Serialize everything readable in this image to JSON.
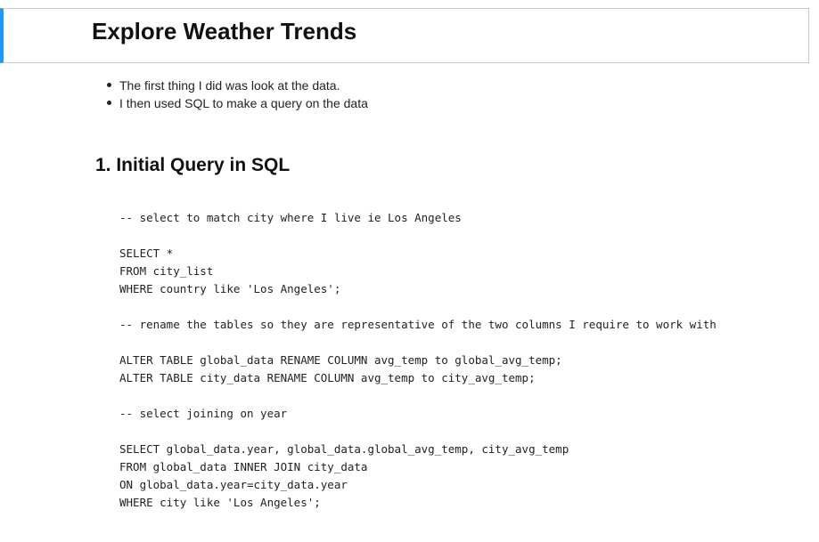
{
  "header": {
    "title": "Explore Weather Trends"
  },
  "intro": {
    "bullets": [
      "The first thing I did was look at the data.",
      "I then used SQL to make a query on the data"
    ]
  },
  "section": {
    "heading": "1. Initial Query in SQL"
  },
  "code": {
    "lines": [
      "-- select to match city where I live ie Los Angeles",
      "",
      "SELECT *",
      "FROM city_list",
      "WHERE country like 'Los Angeles';",
      "",
      "-- rename the tables so they are representative of the two columns I require to work with",
      "",
      "ALTER TABLE global_data RENAME COLUMN avg_temp to global_avg_temp;",
      "ALTER TABLE city_data RENAME COLUMN avg_temp to city_avg_temp;",
      "",
      "-- select joining on year",
      "",
      "SELECT global_data.year, global_data.global_avg_temp, city_avg_temp",
      "FROM global_data INNER JOIN city_data",
      "ON global_data.year=city_data.year",
      "WHERE city like 'Los Angeles';"
    ]
  },
  "colors": {
    "accent": "#2196f3",
    "border": "#c8c8c8",
    "text": "#222222"
  }
}
